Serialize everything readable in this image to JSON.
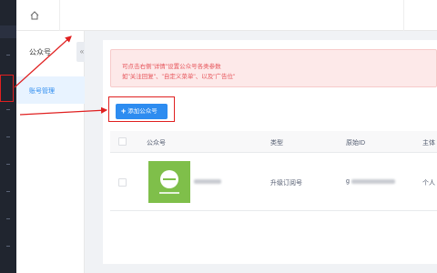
{
  "topbar": {
    "home_icon": "home-icon"
  },
  "subnav": {
    "title": "公众号",
    "collapse_icon": "«",
    "active_item": "账号管理"
  },
  "alert": {
    "line1": "可点击右侧\"详情\"设置公众号各类参数",
    "line2": "如\"关注回复\"、\"自定义菜单\"、以及\"广告位\""
  },
  "add_button": {
    "icon": "+",
    "label": "添加公众号"
  },
  "table": {
    "headers": [
      "公众号",
      "类型",
      "原始ID",
      "主体"
    ],
    "rows": [
      {
        "type": "升级订阅号",
        "original_id_prefix": "g",
        "entity": "个人"
      }
    ]
  },
  "colors": {
    "accent": "#2d8cf0",
    "alert_text": "#e6555b",
    "annotation": "#e02020",
    "sidebar": "#20252f"
  }
}
